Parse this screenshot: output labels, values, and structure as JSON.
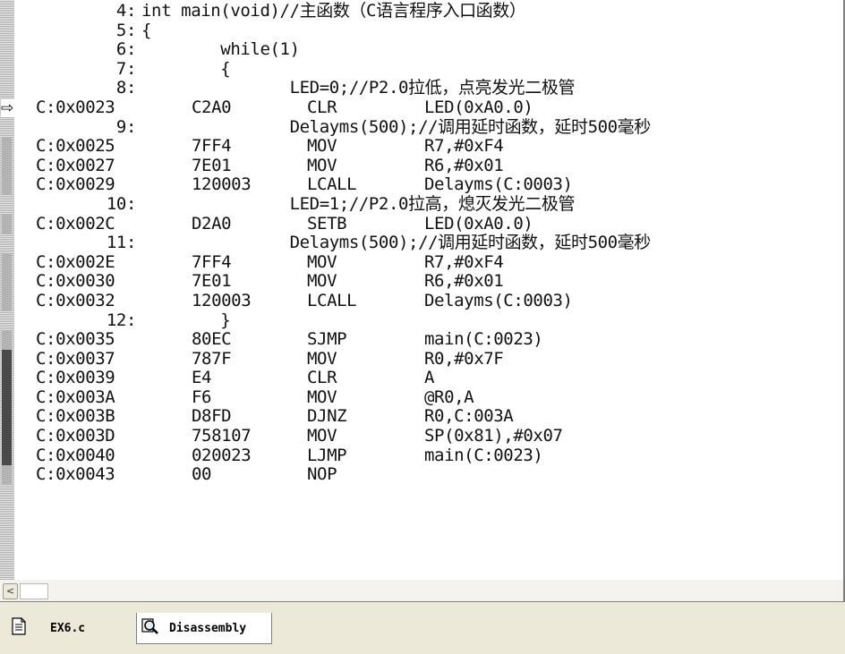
{
  "window": {
    "title": "Disassembly"
  },
  "tabs": [
    {
      "label": "EX6.c",
      "icon": "document-icon",
      "active": false
    },
    {
      "label": "Disassembly",
      "icon": "magnifier-icon",
      "active": true
    }
  ],
  "colors": {
    "coverage": "#b3b3b3",
    "unexecuted": "#4a4a4a",
    "background": "#ffffff"
  },
  "lines": [
    {
      "type": "src",
      "lineno": "4:",
      "text": "int main(void)//主函数（C语言程序入口函数）",
      "marker": "none"
    },
    {
      "type": "src",
      "lineno": "5:",
      "text": "{",
      "marker": "none"
    },
    {
      "type": "src",
      "lineno": "6:",
      "text": "        while(1)",
      "marker": "none"
    },
    {
      "type": "src",
      "lineno": "7:",
      "text": "        {",
      "marker": "none"
    },
    {
      "type": "src",
      "lineno": "8:",
      "text": "               LED=0;//P2.0拉低，点亮发光二极管",
      "marker": "none"
    },
    {
      "type": "asm",
      "addr": "C:0x0023",
      "opcode": "C2A0",
      "mnemonic": "CLR",
      "operands": "LED(0xA0.0)",
      "marker": "current"
    },
    {
      "type": "src",
      "lineno": "9:",
      "text": "               Delayms(500);//调用延时函数，延时500毫秒",
      "marker": "none"
    },
    {
      "type": "asm",
      "addr": "C:0x0025",
      "opcode": "7FF4",
      "mnemonic": "MOV",
      "operands": "R7,#0xF4",
      "marker": "cov"
    },
    {
      "type": "asm",
      "addr": "C:0x0027",
      "opcode": "7E01",
      "mnemonic": "MOV",
      "operands": "R6,#0x01",
      "marker": "cov"
    },
    {
      "type": "asm",
      "addr": "C:0x0029",
      "opcode": "120003",
      "mnemonic": "LCALL",
      "operands": "Delayms(C:0003)",
      "marker": "cov"
    },
    {
      "type": "src",
      "lineno": "10:",
      "text": "               LED=1;//P2.0拉高，熄灭发光二极管",
      "marker": "none"
    },
    {
      "type": "asm",
      "addr": "C:0x002C",
      "opcode": "D2A0",
      "mnemonic": "SETB",
      "operands": "LED(0xA0.0)",
      "marker": "cov"
    },
    {
      "type": "src",
      "lineno": "11:",
      "text": "               Delayms(500);//调用延时函数，延时500毫秒",
      "marker": "none"
    },
    {
      "type": "asm",
      "addr": "C:0x002E",
      "opcode": "7FF4",
      "mnemonic": "MOV",
      "operands": "R7,#0xF4",
      "marker": "cov"
    },
    {
      "type": "asm",
      "addr": "C:0x0030",
      "opcode": "7E01",
      "mnemonic": "MOV",
      "operands": "R6,#0x01",
      "marker": "cov"
    },
    {
      "type": "asm",
      "addr": "C:0x0032",
      "opcode": "120003",
      "mnemonic": "LCALL",
      "operands": "Delayms(C:0003)",
      "marker": "cov"
    },
    {
      "type": "src",
      "lineno": "12:",
      "text": "        }",
      "marker": "none"
    },
    {
      "type": "asm",
      "addr": "C:0x0035",
      "opcode": "80EC",
      "mnemonic": "SJMP",
      "operands": "main(C:0023)",
      "marker": "cov"
    },
    {
      "type": "asm",
      "addr": "C:0x0037",
      "opcode": "787F",
      "mnemonic": "MOV",
      "operands": "R0,#0x7F",
      "marker": "dark"
    },
    {
      "type": "asm",
      "addr": "C:0x0039",
      "opcode": "E4",
      "mnemonic": "CLR",
      "operands": "A",
      "marker": "dark"
    },
    {
      "type": "asm",
      "addr": "C:0x003A",
      "opcode": "F6",
      "mnemonic": "MOV",
      "operands": "@R0,A",
      "marker": "dark"
    },
    {
      "type": "asm",
      "addr": "C:0x003B",
      "opcode": "D8FD",
      "mnemonic": "DJNZ",
      "operands": "R0,C:003A",
      "marker": "dark"
    },
    {
      "type": "asm",
      "addr": "C:0x003D",
      "opcode": "758107",
      "mnemonic": "MOV",
      "operands": "SP(0x81),#0x07",
      "marker": "dark"
    },
    {
      "type": "asm",
      "addr": "C:0x0040",
      "opcode": "020023",
      "mnemonic": "LJMP",
      "operands": "main(C:0023)",
      "marker": "dark"
    },
    {
      "type": "asm",
      "addr": "C:0x0043",
      "opcode": "00",
      "mnemonic": "NOP",
      "operands": "",
      "marker": "cov"
    }
  ],
  "scrollbar": {
    "left_arrow": "<"
  }
}
